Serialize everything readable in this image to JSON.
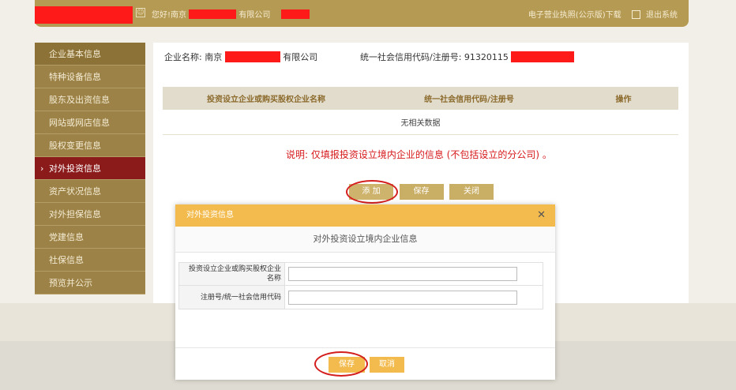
{
  "topbar": {
    "greeting_prefix": "您好!南京",
    "greeting_suffix": "有限公司",
    "license_download": "电子营业执照(公示版)下载",
    "logout": "退出系统"
  },
  "sidebar": {
    "items": [
      {
        "label": "企业基本信息"
      },
      {
        "label": "特种设备信息"
      },
      {
        "label": "股东及出资信息"
      },
      {
        "label": "网站或网店信息"
      },
      {
        "label": "股权变更信息"
      },
      {
        "label": "对外投资信息"
      },
      {
        "label": "资产状况信息"
      },
      {
        "label": "对外担保信息"
      },
      {
        "label": "党建信息"
      },
      {
        "label": "社保信息"
      },
      {
        "label": "预览并公示"
      }
    ]
  },
  "main": {
    "company_label": "企业名称: 南京",
    "company_suffix": "有限公司",
    "credit_label": "统一社会信用代码/注册号: 91320115",
    "table": {
      "headers": [
        "投资设立企业或购买股权企业名称",
        "统一社会信用代码/注册号",
        "操作"
      ],
      "empty_text": "无相关数据"
    },
    "note": "说明: 仅填报投资设立境内企业的信息 (不包括设立的分公司) 。",
    "buttons": {
      "add": "添 加",
      "save": "保存",
      "close": "关闭"
    }
  },
  "modal": {
    "title": "对外投资信息",
    "subtitle": "对外投资设立境内企业信息",
    "fields": [
      {
        "label": "投资设立企业或购买股权企业名称",
        "value": ""
      },
      {
        "label": "注册号/统一社会信用代码",
        "value": ""
      }
    ],
    "save": "保存",
    "cancel": "取消"
  },
  "colors": {
    "accent": "#b59a53",
    "active": "#8b1a1a",
    "modal_header": "#f3bb4d",
    "note": "#d6191b"
  }
}
